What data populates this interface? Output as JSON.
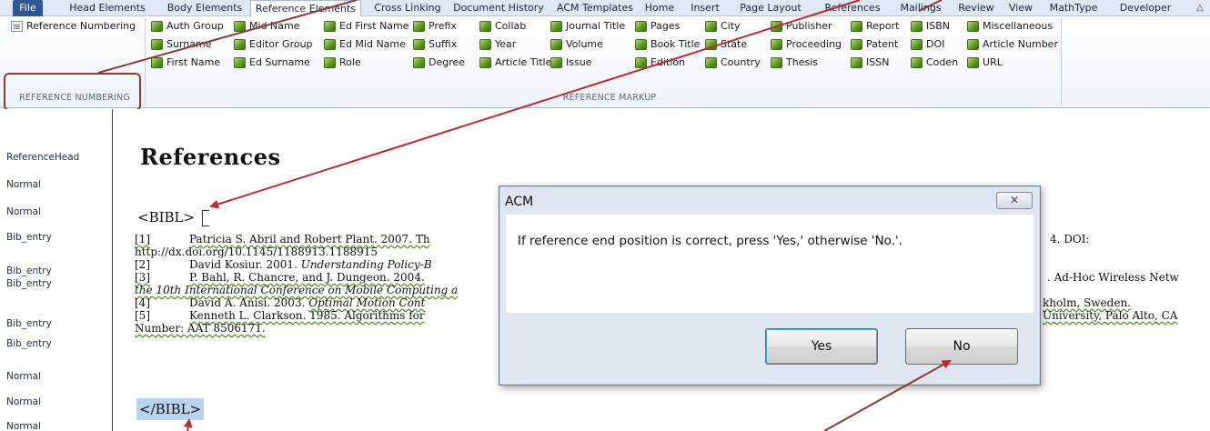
{
  "tabs": [
    "File",
    "Head Elements",
    "Body Elements",
    "Reference Elements",
    "Cross Linking",
    "Document History",
    "ACM Templates",
    "Home",
    "Insert",
    "Page Layout",
    "References",
    "Mailings",
    "Review",
    "View",
    "MathType",
    "Developer"
  ],
  "active_tab": "Reference Elements",
  "ribbon": {
    "ref_numbering": {
      "button": "Reference Numbering",
      "group_label": "REFERENCE NUMBERING"
    },
    "markup_group_label": "REFERENCE MARKUP",
    "markup_buttons": [
      "Auth Group",
      "Surname",
      "First Name",
      "Mid Name",
      "Editor Group",
      "Ed Surname",
      "Ed First Name",
      "Ed Mid Name",
      "Role",
      "Prefix",
      "Suffix",
      "Degree",
      "Collab",
      "Year",
      "Article Title",
      "Journal Title",
      "Volume",
      "Issue",
      "Pages",
      "Book Title",
      "Edition",
      "City",
      "State",
      "Country",
      "Publisher",
      "Proceeding",
      "Thesis",
      "Report",
      "Patent",
      "ISSN",
      "ISBN",
      "DOI",
      "Coden",
      "Miscellaneous",
      "Article Number",
      "URL"
    ]
  },
  "style_pane": [
    "ReferenceHead",
    "Normal",
    "Normal",
    "Bib_entry",
    "Bib_entry",
    "Bib_entry",
    "Bib_entry",
    "Bib_entry",
    "Normal",
    "Normal",
    "Normal"
  ],
  "document": {
    "heading": "References",
    "bibl_open": "<BIBL>",
    "bibl_close": "</BIBL>",
    "entries": [
      {
        "num": "[1]",
        "left": "Patricia S. Abril and Robert Plant. 2007. Th",
        "right": "4. DOI:"
      },
      {
        "num": "",
        "left": "http://dx.doi.org/10.1145/1188913.1188915",
        "right": ""
      },
      {
        "num": "[2]",
        "left": "David Kosiur. 2001. ",
        "left_italic": "Understanding Policy-B",
        "right": ""
      },
      {
        "num": "[3]",
        "left": "P. Bahl, R. Chancre, and J. Dungeon. 2004.",
        "right": ". Ad-Hoc Wireless Netw"
      },
      {
        "num": "",
        "left_italic": "the 10th International Conference on Mobile Computing a",
        "right": ""
      },
      {
        "num": "[4]",
        "left": "David A. Anisi. 2003. ",
        "left_italic": "Optimal Motion Cont",
        "right": "kholm, Sweden."
      },
      {
        "num": "[5]",
        "left": "Kenneth L. Clarkson. 1985. Algorithms for",
        "right": "University, Palo Alto, CA"
      },
      {
        "num": "",
        "left": "Number: AAT 8506171.",
        "right": ""
      }
    ]
  },
  "dialog": {
    "title": "ACM",
    "close_glyph": "✕",
    "message": "If reference end position is correct, press 'Yes,' otherwise 'No.'.",
    "yes": "Yes",
    "no": "No"
  },
  "colors": {
    "annotation_arrow": "#c0282d",
    "annotation_box": "#8b3a32",
    "selection": "#b7d3ee",
    "file_tab": "#2b5797"
  }
}
